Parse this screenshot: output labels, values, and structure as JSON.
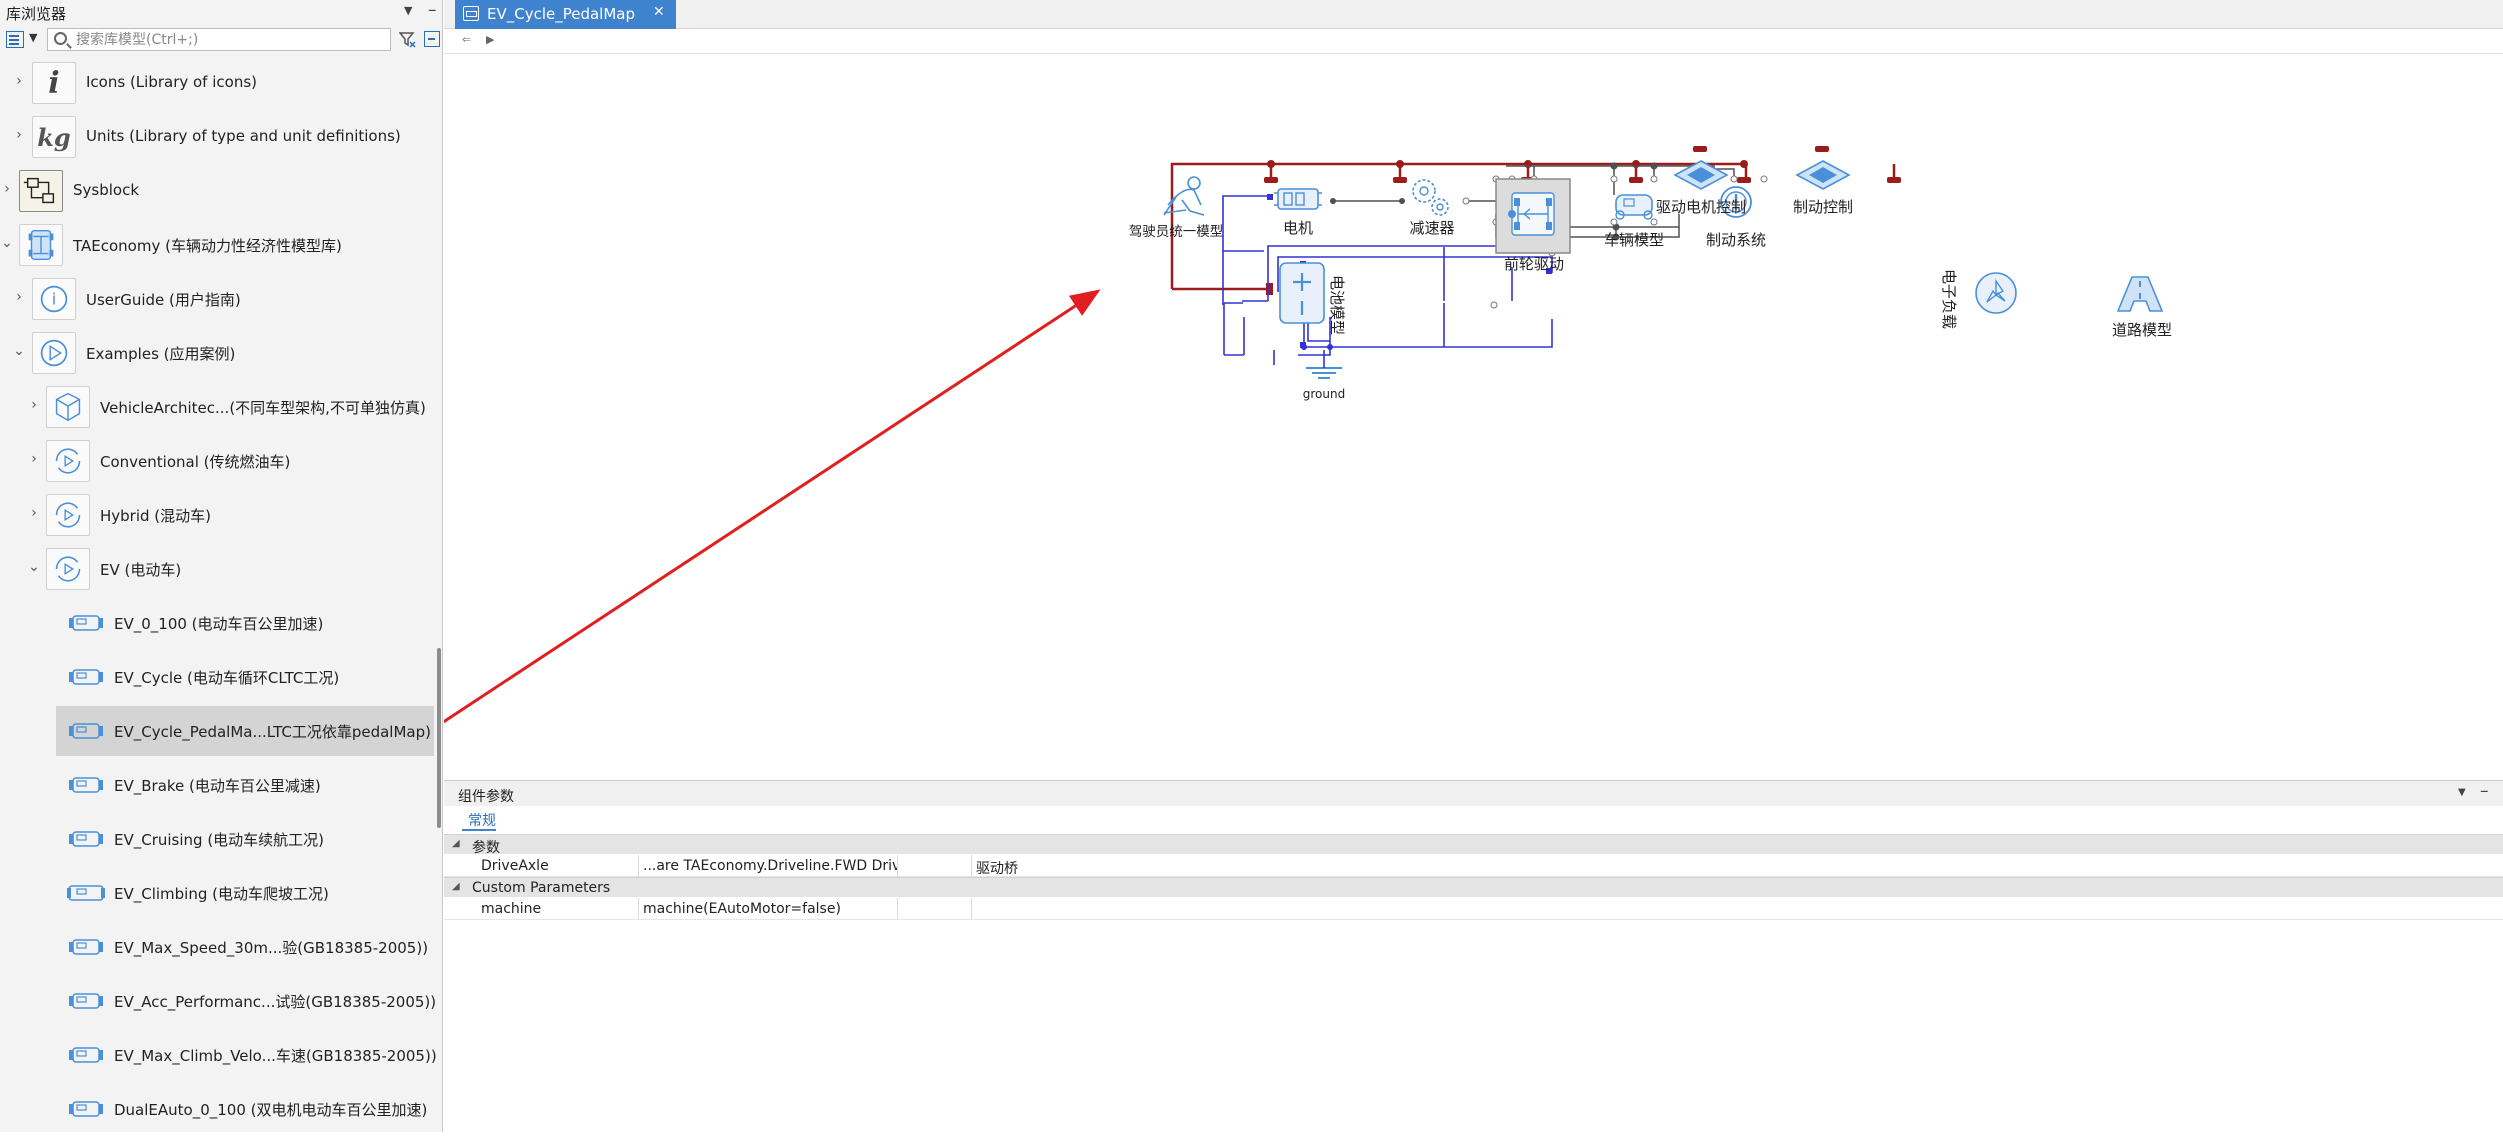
{
  "library_browser": {
    "title": "库浏览器",
    "search_placeholder": "搜索库模型(Ctrl+;)",
    "items": [
      {
        "label": "Icons (Library of icons)"
      },
      {
        "label": "Units (Library of type and unit definitions)"
      },
      {
        "label": "Sysblock"
      },
      {
        "label": "TAEconomy (车辆动力性经济性模型库)"
      },
      {
        "label": "UserGuide (用户指南)"
      },
      {
        "label": "Examples (应用案例)"
      },
      {
        "label": "VehicleArchitec...(不同车型架构,不可单独仿真)"
      },
      {
        "label": "Conventional (传统燃油车)"
      },
      {
        "label": "Hybrid (混动车)"
      },
      {
        "label": "EV (电动车)"
      },
      {
        "label": "EV_0_100 (电动车百公里加速)"
      },
      {
        "label": "EV_Cycle (电动车循环CLTC工况)"
      },
      {
        "label": "EV_Cycle_PedalMa...LTC工况依靠pedalMap)"
      },
      {
        "label": "EV_Brake (电动车百公里减速)"
      },
      {
        "label": "EV_Cruising (电动车续航工况)"
      },
      {
        "label": "EV_Climbing (电动车爬坡工况)"
      },
      {
        "label": "EV_Max_Speed_30m...验(GB18385-2005))"
      },
      {
        "label": "EV_Acc_Performanc...试验(GB18385-2005))"
      },
      {
        "label": "EV_Max_Climb_Velo...车速(GB18385-2005))"
      },
      {
        "label": "DualEAuto_0_100 (双电机电动车百公里加速)"
      }
    ]
  },
  "editor": {
    "tab_label": "EV_Cycle_PedalMap",
    "diagram": {
      "blocks": {
        "driver": "驾驶员统一模型",
        "motor": "电机",
        "reducer": "减速器",
        "front_drive": "前轮驱动",
        "vehicle": "车辆模型",
        "brake": "制动系统",
        "motor_control": "驱动电机控制",
        "brake_control": "制动控制",
        "battery": "电池模型",
        "elec_load": "电子负载",
        "road": "道路模型",
        "ground": "ground"
      },
      "colors": {
        "bus": "#9b1c1c",
        "signal": "#3232d6",
        "mech": "#505050",
        "arrow": "#e02020",
        "icon": "#4a90d9"
      }
    }
  },
  "params_panel": {
    "title": "组件参数",
    "tab": "常规",
    "groups": [
      {
        "label": "参数",
        "rows": [
          {
            "name": "DriveAxle",
            "value": "...are TAEconomy.Driveline.FWD DriveAxle",
            "unit": "",
            "desc": "驱动桥"
          }
        ]
      },
      {
        "label": "Custom Parameters",
        "rows": [
          {
            "name": "machine",
            "value": "machine(EAutoMotor=false)",
            "unit": "",
            "desc": ""
          }
        ]
      }
    ]
  }
}
